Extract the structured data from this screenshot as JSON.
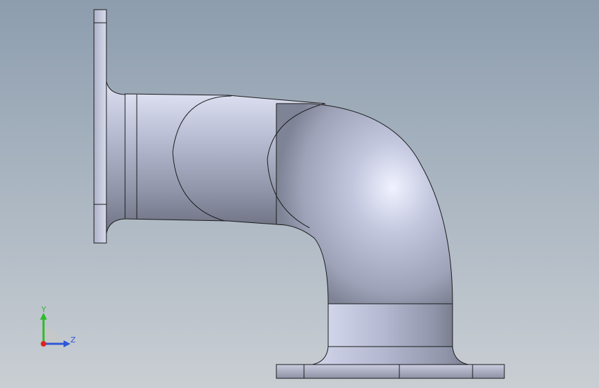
{
  "view": {
    "background_top": "#8d9dae",
    "background_bottom": "#c9ced3",
    "part_color": "#b9bdd4"
  },
  "triad": {
    "y_label": "Y",
    "z_label": "Z",
    "y_color": "#2dbb2d",
    "z_color": "#2f56d6",
    "x_color": "#e02020"
  }
}
